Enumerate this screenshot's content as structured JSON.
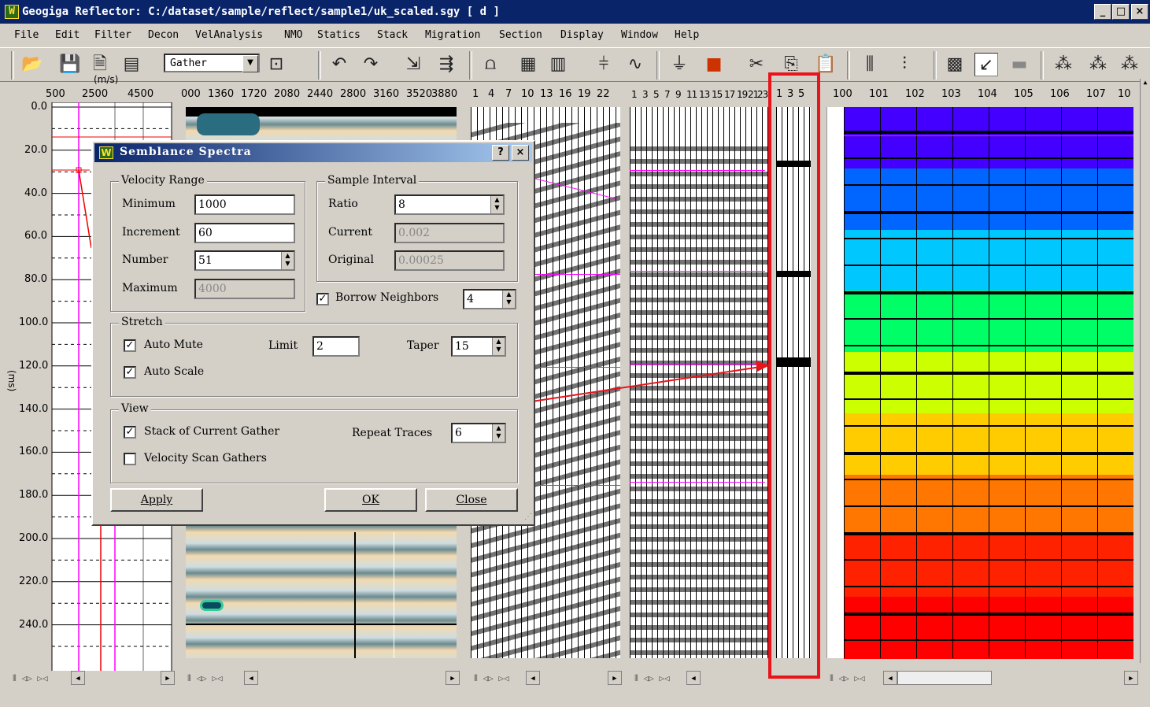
{
  "window": {
    "logo": "W",
    "title": "Geogiga Reflector: C:/dataset/sample/reflect/sample1/uk_scaled.sgy [ d ]",
    "controls": [
      "_",
      "□",
      "×"
    ]
  },
  "menu": [
    "File",
    "Edit",
    "Filter",
    "Decon",
    "VelAnalysis",
    "NMO",
    "Statics",
    "Stack",
    "Migration",
    "Section",
    "Display",
    "Window",
    "Help"
  ],
  "toolbar": {
    "gather_select": "Gather",
    "icons": [
      "open-folder-icon",
      "save-icon",
      "save-all-icon",
      "image-icon",
      "select-arrow-icon",
      "undo-icon",
      "redo-icon",
      "pick-icon",
      "filter-icon",
      "spectrum-icon",
      "fk-icon",
      "trace-icon",
      "wiggle-icon",
      "velocity-icon",
      "color-icon",
      "cut-icon",
      "copy-icon",
      "paste-icon",
      "mute-icon",
      "add-icon",
      "pattern-icon",
      "arrow-icon",
      "gray-icon",
      "stack-icon"
    ]
  },
  "velocity_panel": {
    "unit": "(m/s)",
    "x_ticks": [
      "500",
      "2500",
      "4500"
    ],
    "y_ticks": [
      "0.0",
      "20.0",
      "40.0",
      "60.0",
      "80.0",
      "100.0",
      "120.0",
      "140.0",
      "160.0",
      "180.0",
      "200.0",
      "220.0",
      "240.0"
    ],
    "y_unit": "(ms)"
  },
  "semblance_panel": {
    "x_ticks": [
      "000",
      "1360",
      "1720",
      "2080",
      "2440",
      "2800",
      "3160",
      "3520",
      "3880"
    ]
  },
  "gather_panel": {
    "x_ticks": [
      "1",
      "4",
      "7",
      "10",
      "13",
      "16",
      "19",
      "22"
    ]
  },
  "nmo_panel": {
    "x_ticks": [
      "1",
      "3",
      "5",
      "7",
      "9",
      "11",
      "13",
      "15",
      "17",
      "19",
      "21",
      "23"
    ]
  },
  "stack_panel": {
    "x_ticks": [
      "1",
      "3",
      "5"
    ]
  },
  "section_panel": {
    "x_ticks": [
      "100",
      "101",
      "102",
      "103",
      "104",
      "105",
      "106",
      "107",
      "10"
    ],
    "colors": [
      "#4400ff",
      "#0066ff",
      "#00c8ff",
      "#00ff66",
      "#ccff00",
      "#ffcc00",
      "#ff7700",
      "#ff2200",
      "#ff0000"
    ]
  },
  "dialog": {
    "title": "Semblance Spectra",
    "velocity_range": {
      "caption": "Velocity Range",
      "minimum_label": "Minimum",
      "minimum": "1000",
      "increment_label": "Increment",
      "increment": "60",
      "number_label": "Number",
      "number": "51",
      "maximum_label": "Maximum",
      "maximum": "4000"
    },
    "sample_interval": {
      "caption": "Sample Interval",
      "ratio_label": "Ratio",
      "ratio": "8",
      "current_label": "Current",
      "current": "0.002",
      "original_label": "Original",
      "original": "0.00025"
    },
    "borrow_neighbors_label": "Borrow Neighbors",
    "borrow_neighbors": "4",
    "stretch": {
      "caption": "Stretch",
      "auto_mute_label": "Auto Mute",
      "limit_label": "Limit",
      "limit": "2",
      "taper_label": "Taper",
      "taper": "15",
      "auto_scale_label": "Auto Scale"
    },
    "view": {
      "caption": "View",
      "stack_label": "Stack of Current Gather",
      "repeat_label": "Repeat Traces",
      "repeat": "6",
      "velocity_scan_label": "Velocity Scan Gathers"
    },
    "apply": "Apply",
    "ok": "OK",
    "close": "Close",
    "help": "?",
    "x": "×"
  }
}
